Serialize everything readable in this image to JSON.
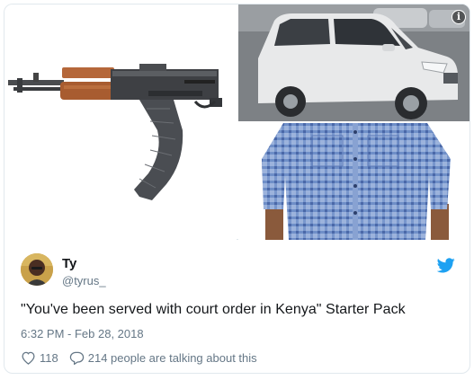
{
  "tweet": {
    "display_name": "Ty",
    "handle": "@tyrus_",
    "text": "\"You've been served with court order in Kenya\" Starter Pack",
    "timestamp": "6:32 PM - Feb 28, 2018",
    "like_count": "118",
    "talking_text": "214 people are talking about this"
  },
  "media": {
    "images": [
      "rifle",
      "white-suv",
      "checkered-shirt"
    ],
    "info_label": "i"
  },
  "colors": {
    "brand": "#1da1f2",
    "text_primary": "#14171a",
    "text_secondary": "#657786",
    "border": "#e1e8ed"
  },
  "icons": [
    "info-icon",
    "twitter-bird-icon",
    "heart-icon",
    "reply-icon"
  ]
}
